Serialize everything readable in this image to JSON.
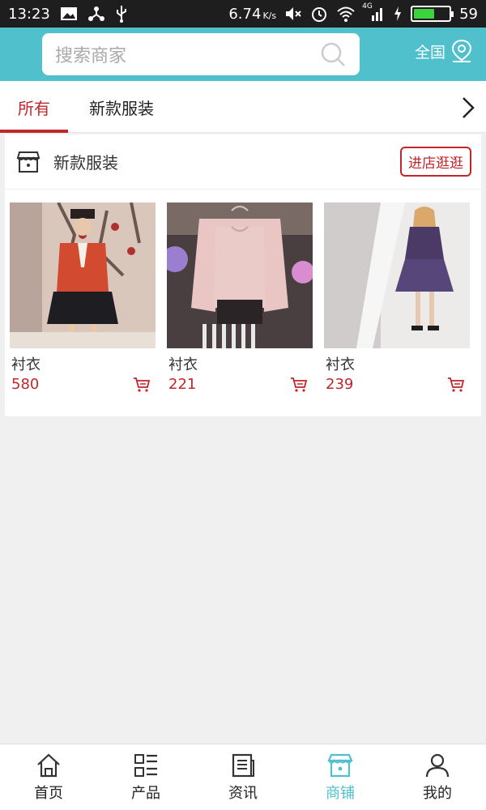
{
  "status_bar": {
    "time": "13:23",
    "speed": "6.74",
    "speed_unit": "K/s",
    "network": "4G",
    "battery": "59",
    "battery_level": 0.59
  },
  "header": {
    "search_placeholder": "搜索商家",
    "location": "全国"
  },
  "tabs": [
    {
      "label": "所有",
      "active": true
    },
    {
      "label": "新款服装",
      "active": false
    }
  ],
  "store": {
    "name": "新款服装",
    "visit_label": "进店逛逛",
    "products": [
      {
        "name": "衬衣",
        "price": "580"
      },
      {
        "name": "衬衣",
        "price": "221"
      },
      {
        "name": "衬衣",
        "price": "239"
      }
    ]
  },
  "bottom_nav": [
    {
      "label": "首页",
      "icon": "home-icon"
    },
    {
      "label": "产品",
      "icon": "grid-list-icon"
    },
    {
      "label": "资讯",
      "icon": "news-icon"
    },
    {
      "label": "商铺",
      "icon": "shop-icon",
      "active": true
    },
    {
      "label": "我的",
      "icon": "user-icon"
    }
  ],
  "colors": {
    "accent": "#4fc0cc",
    "brand_red": "#c0262a"
  }
}
